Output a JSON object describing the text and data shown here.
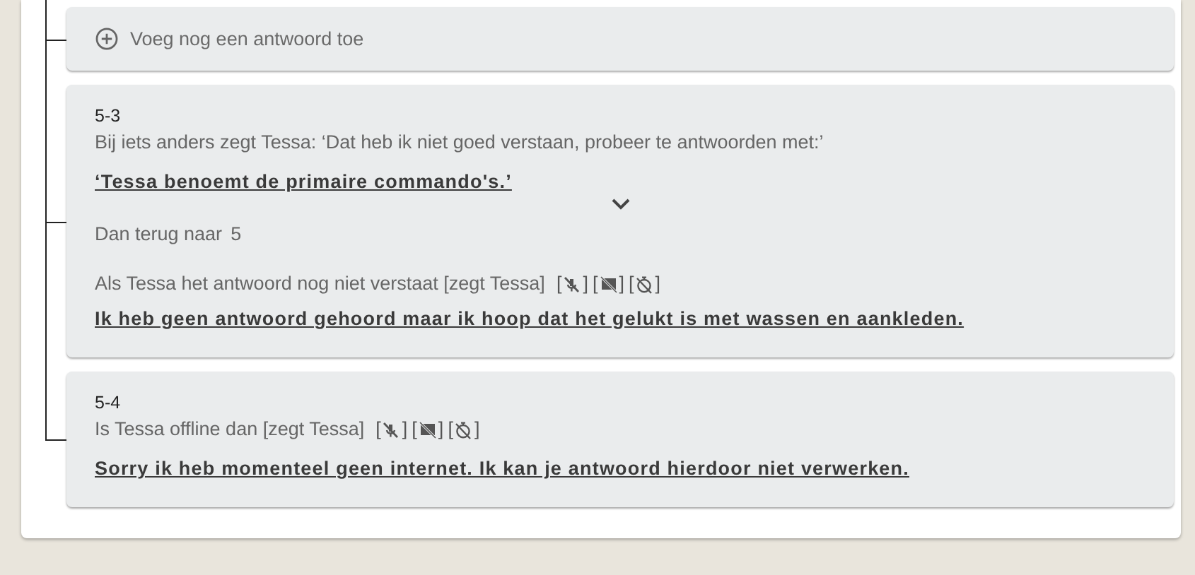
{
  "add_answer": {
    "label": "Voeg nog een antwoord toe"
  },
  "answers": [
    {
      "id": "5-3",
      "condition": "Bij iets anders zegt Tessa: ‘Dat heb ik niet goed verstaan, probeer te antwoorden met:’",
      "response": "‘Tessa benoemt de primaire commando's.’",
      "expanded": false,
      "followup": {
        "label": "Dan terug naar",
        "target": "5"
      },
      "fallback": {
        "condition": "Als Tessa het antwoord nog niet verstaat [zegt Tessa]",
        "flags": [
          {
            "kind": "mic-off",
            "left": "[",
            "right": "]"
          },
          {
            "kind": "screen-off",
            "left": "[",
            "right": "]"
          },
          {
            "kind": "timer-off",
            "left": "[",
            "right": "]"
          }
        ],
        "response": "Ik heb geen antwoord gehoord maar ik hoop dat het gelukt is met wassen en aankleden."
      }
    },
    {
      "id": "5-4",
      "condition": "Is Tessa offline dan [zegt Tessa]",
      "flags": [
        {
          "kind": "mic-off",
          "left": "[",
          "right": "]"
        },
        {
          "kind": "screen-off",
          "left": "[",
          "right": "]"
        },
        {
          "kind": "timer-off",
          "left": "[",
          "right": "]"
        }
      ],
      "response": "Sorry ik heb momenteel geen internet. Ik kan je antwoord hierdoor niet verwerken."
    }
  ]
}
